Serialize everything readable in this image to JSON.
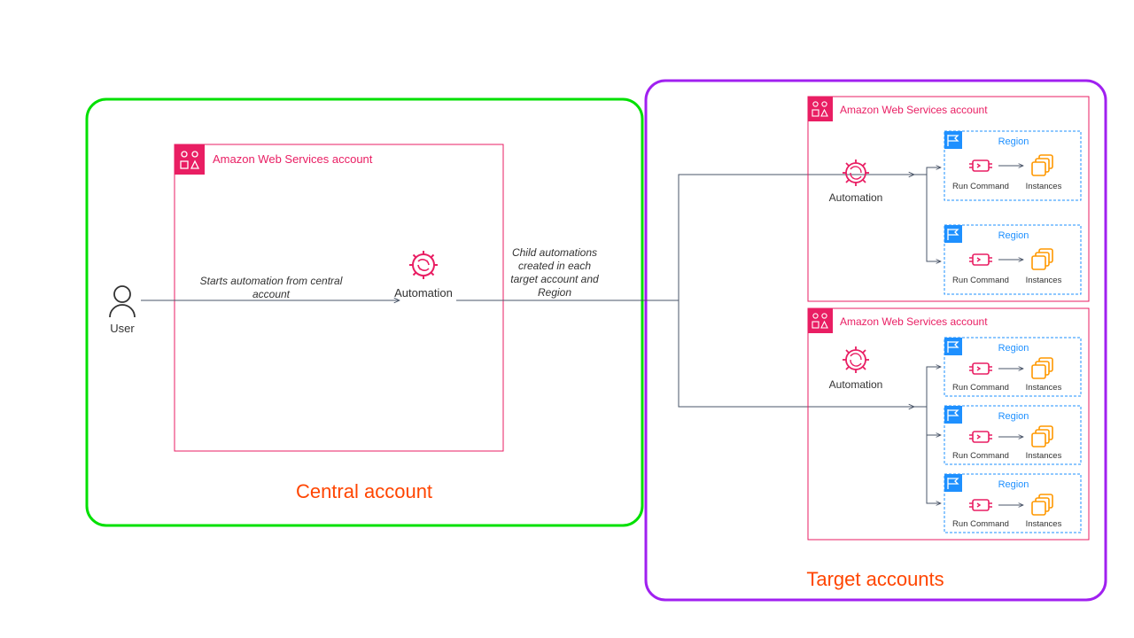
{
  "central": {
    "title": "Central account",
    "user_label": "User",
    "automation_label": "Automation",
    "start_text_1": "Starts automation from central",
    "start_text_2": "account",
    "child_text_1": "Child automations",
    "child_text_2": "created in each",
    "child_text_3": "target account and",
    "child_text_4": "Region",
    "aws_account_label": "Amazon Web Services account"
  },
  "target": {
    "title": "Target accounts",
    "aws_account_label": "Amazon Web Services account",
    "automation_label": "Automation",
    "region_label": "Region",
    "run_command_label": "Run Command",
    "instances_label": "Instances"
  },
  "colors": {
    "green": "#00e000",
    "purple": "#a020f0",
    "pink": "#e91e63",
    "red_text": "#ff4500",
    "blue": "#1e90ff",
    "orange": "#ff9800",
    "gray": "#4a5568"
  }
}
